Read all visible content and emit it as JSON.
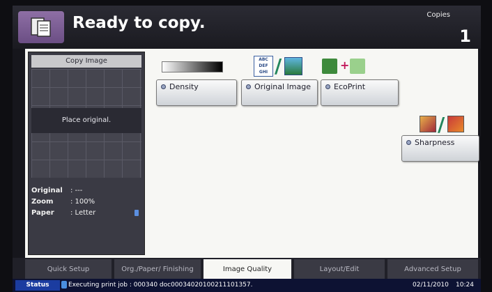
{
  "header": {
    "title": "Ready to copy.",
    "copies_label": "Copies",
    "copies_value": "1"
  },
  "preview": {
    "title": "Copy Image",
    "message": "Place original.",
    "info": [
      {
        "key": "Original",
        "value": ": ---"
      },
      {
        "key": "Zoom",
        "value": ": 100%"
      },
      {
        "key": "Paper",
        "value": ": Letter"
      }
    ]
  },
  "buttons": {
    "density": "Density",
    "original_image": "Original Image",
    "ecoprint": "EcoPrint",
    "sharpness": "Sharpness"
  },
  "icons": {
    "abc_text": "ABC DEF GHI"
  },
  "tabs": [
    {
      "label": "Quick Setup",
      "active": false
    },
    {
      "label": "Org./Paper/ Finishing",
      "active": false
    },
    {
      "label": "Image Quality",
      "active": true
    },
    {
      "label": "Layout/Edit",
      "active": false
    },
    {
      "label": "Advanced Setup",
      "active": false
    }
  ],
  "statusbar": {
    "status_button": "Status",
    "message": "Executing print job : 000340 doc00034020100211101357.",
    "date": "02/11/2010",
    "time": "10:24"
  },
  "colors": {
    "accent": "#6b4e84",
    "status_bar": "#0d1233",
    "status_button": "#1b3ca0"
  }
}
